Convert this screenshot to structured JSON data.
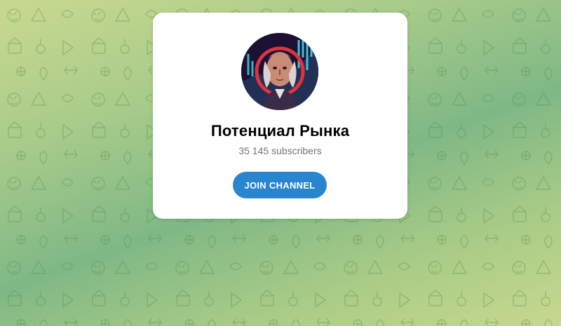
{
  "channel": {
    "name": "Потенциал Рынка",
    "subscribers": "35 145 subscribers",
    "join_label": "JOIN CHANNEL",
    "avatar_icon": "portrait-avatar"
  },
  "colors": {
    "button": "#2a85cf",
    "subscribers_text": "#707579",
    "background_top": "#c9d98f",
    "background_mid": "#7fb885"
  }
}
